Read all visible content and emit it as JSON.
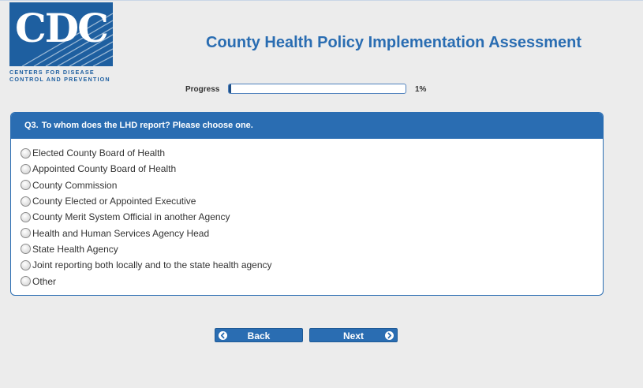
{
  "logo": {
    "letters": "CDC",
    "caption_line1": "Centers for Disease",
    "caption_line2": "Control and Prevention",
    "brand_color": "#1e5fa0"
  },
  "header": {
    "title": "County Health Policy Implementation Assessment",
    "title_color": "#2a6db2"
  },
  "progress": {
    "label": "Progress",
    "value_text": "1%",
    "value": 1
  },
  "question": {
    "number": "Q3.",
    "text": "To whom does the LHD report? Please choose one.",
    "options": [
      "Elected County Board of Health",
      "Appointed County Board of Health",
      "County Commission",
      "County Elected or Appointed Executive",
      "County Merit System Official in another Agency",
      "Health and Human Services Agency Head",
      "State Health Agency",
      "Joint reporting both locally and to the state health agency",
      "Other"
    ]
  },
  "nav": {
    "back_label": "Back",
    "next_label": "Next",
    "back_icon": "circle-arrow-left-icon",
    "next_icon": "circle-arrow-right-icon"
  }
}
